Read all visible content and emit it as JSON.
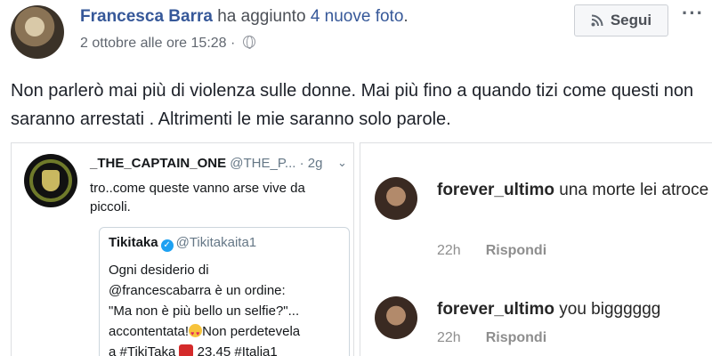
{
  "post": {
    "author": "Francesca Barra",
    "action_prefix": " ha aggiunto ",
    "action_link": "4 nuove foto",
    "action_suffix": ".",
    "timestamp": "2 ottobre alle ore 15:28 · ",
    "follow_label": "Segui",
    "more_label": "···",
    "text": "Non parlerò mai più di violenza sulle donne. Mai più fino a quando tizi come questi non saranno arrestati . Altrimenti le mie saranno solo parole."
  },
  "tweet": {
    "author": "_THE_CAPTAIN_ONE",
    "handle": " @THE_P... · 2g",
    "chevron": "⌄",
    "text": "tro..come queste vanno arse vive da piccoli.",
    "quote": {
      "author": "Tikitaka",
      "handle": "@Tikitakaita1",
      "line1": "Ogni desiderio di",
      "line2": "@francescabarra è un ordine:",
      "line3": "\"Ma non è più bello un selfie?\"...",
      "line4a": "accontentata!",
      "line4b": "Non perdetevela",
      "line5a": "a #TikiTaka ",
      "line5b": " 23.45 #Italia1"
    }
  },
  "comments": [
    {
      "user": "forever_ultimo",
      "text": " una morte lei atroce",
      "time": "22h",
      "reply": "Rispondi"
    },
    {
      "user": "forever_ultimo",
      "text": " you bigggggg",
      "time": "22h",
      "reply": "Rispondi"
    }
  ],
  "icons": {
    "follow": "rss-icon",
    "privacy": "globe-icon",
    "verified": "verified-icon"
  },
  "colors": {
    "link": "#365899",
    "twitter_blue": "#1da1f2",
    "meta_gray": "#616770"
  }
}
